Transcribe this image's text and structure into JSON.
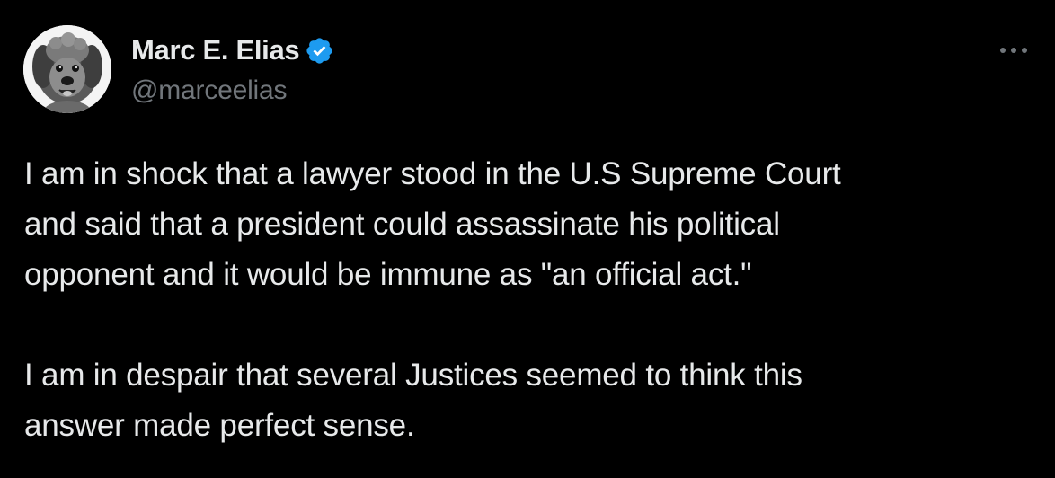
{
  "author": {
    "display_name": "Marc E. Elias",
    "handle": "@marceelias",
    "verified": true,
    "verified_color": "#1d9bf0"
  },
  "icons": {
    "verified": "verified-badge-icon",
    "more": "more-options-icon"
  },
  "tweet": {
    "paragraphs": [
      {
        "lines": [
          "I am in shock that a lawyer stood in the U.S Supreme Court",
          "and said that a president could assassinate his political",
          "opponent and it would be immune as \"an official act.\""
        ]
      },
      {
        "lines": [
          "I am in despair that several Justices seemed to think this",
          "answer made perfect sense."
        ]
      }
    ]
  },
  "colors": {
    "background": "#000000",
    "primary_text": "#e7e9ea",
    "secondary_text": "#71767b"
  }
}
